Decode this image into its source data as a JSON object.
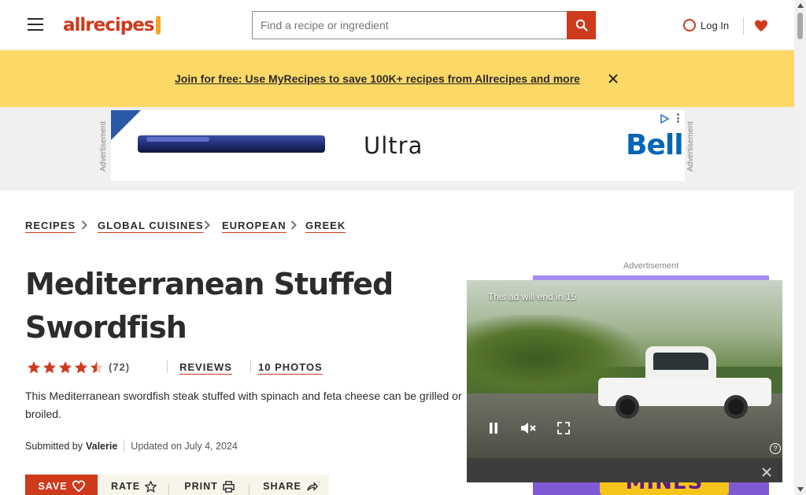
{
  "header": {
    "logo_text": "allrecipes",
    "search_placeholder": "Find a recipe or ingredient",
    "login_label": "Log In"
  },
  "promo": {
    "link_text": "Join for free: Use MyRecipes to save 100K+ recipes from Allrecipes and more"
  },
  "ad_banner": {
    "label": "Advertisement",
    "product": "Ultra",
    "brand": "Bell"
  },
  "breadcrumbs": [
    {
      "label": "RECIPES"
    },
    {
      "label": "GLOBAL CUISINES"
    },
    {
      "label": "EUROPEAN"
    },
    {
      "label": "GREEK"
    }
  ],
  "recipe": {
    "title": "Mediterranean Stuffed Swordfish",
    "rating_value": 4.5,
    "rating_count": "(72)",
    "reviews_label": "REVIEWS",
    "photos_label": "10 PHOTOS",
    "description": "This Mediterranean swordfish steak stuffed with spinach and feta cheese can be grilled or broiled.",
    "submitted_by_label": "Submitted by",
    "author": "Valerie",
    "updated": "Updated on July 4, 2024"
  },
  "actions": {
    "save": "SAVE",
    "rate": "RATE",
    "print": "PRINT",
    "share": "SHARE"
  },
  "rail_ad": {
    "label": "Advertisement",
    "word": "MINES"
  },
  "video_ad": {
    "countdown": "This ad will end in 15"
  },
  "colors": {
    "brand": "#ce3a1c",
    "promo_bg": "#fcd866",
    "action_bar_bg": "#f7f4e9"
  }
}
